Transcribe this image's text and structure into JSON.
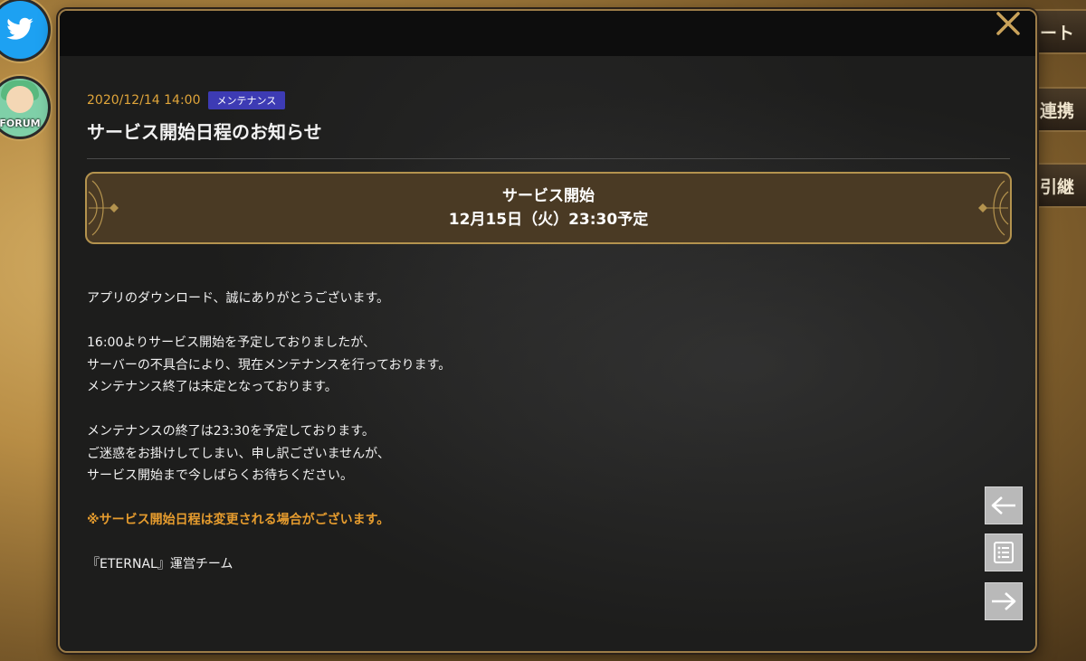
{
  "sidebar": {
    "forum_label": "FORUM"
  },
  "right_tabs": [
    "ポート",
    "タ連携",
    "タ引継"
  ],
  "notice": {
    "date": "2020/12/14 14:00",
    "tag": "メンテナンス",
    "title": "サービス開始日程のお知らせ",
    "banner_line1": "サービス開始",
    "banner_line2": "12月15日（火）23:30予定",
    "paragraphs": [
      [
        "アプリのダウンロード、誠にありがとうございます。"
      ],
      [
        "16:00よりサービス開始を予定しておりましたが、",
        "サーバーの不具合により、現在メンテナンスを行っております。",
        "メンテナンス終了は未定となっております。"
      ],
      [
        "メンテナンスの終了は23:30を予定しております。",
        "ご迷惑をお掛けしてしまい、申し訳ございませんが、",
        "サービス開始まで今しばらくお待ちください。"
      ]
    ],
    "warning": "※サービス開始日程は変更される場合がございます。",
    "signature": "『ETERNAL』運営チーム"
  },
  "colors": {
    "date": "#e0a53a",
    "tag_bg": "#3d3bb4",
    "warning": "#e69c2e",
    "banner_border": "#b4934e",
    "close_icon": "#c9a25a"
  },
  "icons": {
    "close": "close-icon",
    "prev": "arrow-left-icon",
    "list": "list-icon",
    "next": "arrow-right-icon"
  }
}
